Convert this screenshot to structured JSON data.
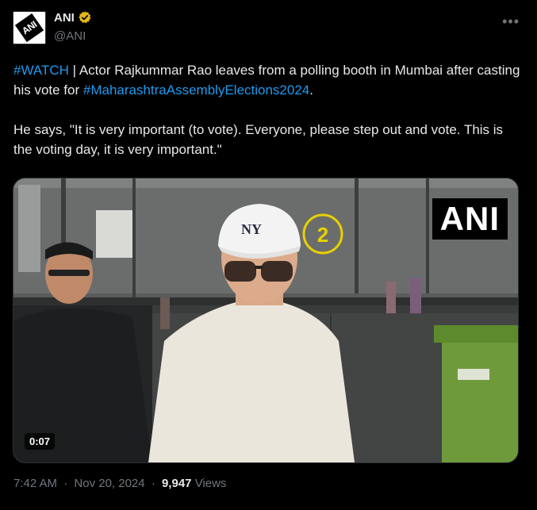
{
  "author": {
    "display_name": "ANI",
    "handle": "@ANI",
    "avatar_text": "ANI"
  },
  "tweet": {
    "hashtag_watch": "#WATCH",
    "text_part1": " | Actor Rajkummar Rao leaves from a polling booth in Mumbai after casting his vote for ",
    "hashtag_election": "#MaharashtraAssemblyElections2024",
    "text_part2": ".",
    "quote": "He says, \"It is very important (to vote). Everyone, please step out and vote. This is the voting day, it is very important.\""
  },
  "media": {
    "watermark": "ANI",
    "duration": "0:07",
    "cap_logo": "NY"
  },
  "meta": {
    "time": "7:42 AM",
    "date": "Nov 20, 2024",
    "separator": "·",
    "views_count": "9,947",
    "views_label": "Views"
  },
  "colors": {
    "background": "#000000",
    "text": "#e7e9ea",
    "secondary": "#71767b",
    "link": "#1d9bf0",
    "verified": "#e2b719"
  },
  "icons": {
    "verified": "verified-badge-icon",
    "more": "more-options-icon"
  }
}
